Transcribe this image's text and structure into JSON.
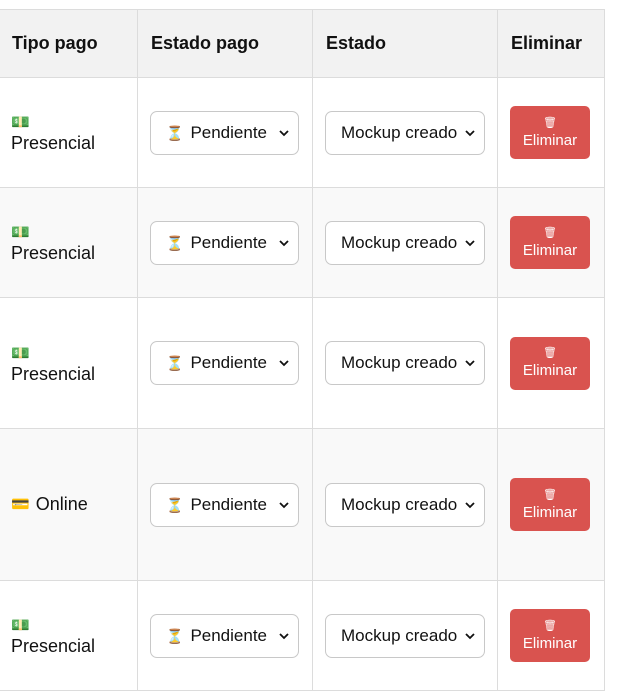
{
  "headers": {
    "tipo_pago": "Tipo pago",
    "estado_pago": "Estado pago",
    "estado": "Estado",
    "eliminar": "Eliminar"
  },
  "icons": {
    "cash": "💵",
    "card": "💳",
    "hourglass": "⏳",
    "trash": "🗑"
  },
  "colors": {
    "delete_button": "#d9534f",
    "header_bg": "#f2f2f2"
  },
  "rows": [
    {
      "tipo_pago": "Presencial",
      "tipo_icon": "💵",
      "estado_pago": "Pendiente",
      "estado": "Mockup creado",
      "accion": "Eliminar"
    },
    {
      "tipo_pago": "Presencial",
      "tipo_icon": "💵",
      "estado_pago": "Pendiente",
      "estado": "Mockup creado",
      "accion": "Eliminar"
    },
    {
      "tipo_pago": "Presencial",
      "tipo_icon": "💵",
      "estado_pago": "Pendiente",
      "estado": "Mockup creado",
      "accion": "Eliminar"
    },
    {
      "tipo_pago": "Online",
      "tipo_icon": "💳",
      "estado_pago": "Pendiente",
      "estado": "Mockup creado",
      "accion": "Eliminar"
    },
    {
      "tipo_pago": "Presencial",
      "tipo_icon": "💵",
      "estado_pago": "Pendiente",
      "estado": "Mockup creado",
      "accion": "Eliminar"
    }
  ]
}
